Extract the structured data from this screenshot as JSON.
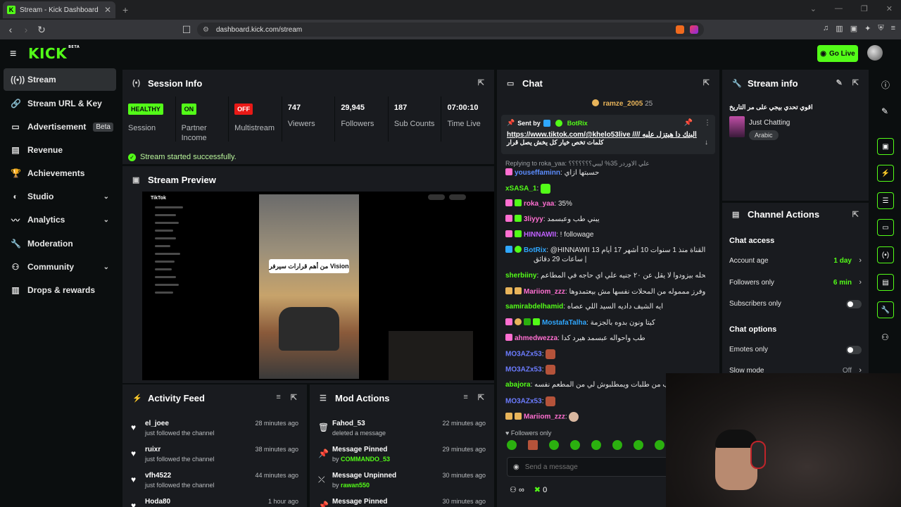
{
  "browser": {
    "tab_title": "Stream - Kick Dashboard",
    "url": "dashboard.kick.com/stream"
  },
  "header": {
    "logo": "KICK",
    "logo_badge": "BETA",
    "go_live": "Go Live"
  },
  "sidebar": {
    "items": [
      {
        "label": "Stream",
        "icon": "broadcast-icon"
      },
      {
        "label": "Stream URL & Key",
        "icon": "link-icon"
      },
      {
        "label": "Advertisement",
        "icon": "ad-icon",
        "badge": "Beta"
      },
      {
        "label": "Revenue",
        "icon": "chart-icon"
      },
      {
        "label": "Achievements",
        "icon": "trophy-icon"
      },
      {
        "label": "Studio",
        "icon": "palette-icon"
      },
      {
        "label": "Analytics",
        "icon": "analytics-icon"
      },
      {
        "label": "Moderation",
        "icon": "wrench-icon"
      },
      {
        "label": "Community",
        "icon": "community-icon"
      },
      {
        "label": "Drops & rewards",
        "icon": "gift-icon"
      }
    ]
  },
  "session": {
    "title": "Session Info",
    "stats": [
      {
        "badge": "HEALTHY",
        "label": "Session"
      },
      {
        "badge": "ON",
        "label": "Partner Income"
      },
      {
        "badge": "OFF",
        "label": "Multistream"
      },
      {
        "value": "747",
        "label": "Viewers"
      },
      {
        "value": "29,945",
        "label": "Followers"
      },
      {
        "value": "187",
        "label": "Sub Counts"
      },
      {
        "value": "07:00:10",
        "label": "Time Live"
      }
    ],
    "success": "Stream started successfully."
  },
  "preview": {
    "title": "Stream Preview",
    "tiktok_logo": "TikTok",
    "caption": "من أهم قرارات سيرفر Vision"
  },
  "activity": {
    "title": "Activity Feed",
    "items": [
      {
        "name": "el_joee",
        "text": "just followed the channel",
        "time": "28 minutes ago"
      },
      {
        "name": "ruixr",
        "text": "just followed the channel",
        "time": "38 minutes ago"
      },
      {
        "name": "vfh4522",
        "text": "just followed the channel",
        "time": "44 minutes ago"
      },
      {
        "name": "Hoda80",
        "text": "",
        "time": "1 hour ago"
      }
    ]
  },
  "mod": {
    "title": "Mod Actions",
    "items": [
      {
        "name": "Fahod_53",
        "text": "deleted a message",
        "by": "",
        "time": "22 minutes ago"
      },
      {
        "name": "Message Pinned",
        "text": "by ",
        "by": "COMMANDO_53",
        "time": "29 minutes ago"
      },
      {
        "name": "Message Unpinned",
        "text": "by ",
        "by": "rawan550",
        "time": "30 minutes ago"
      },
      {
        "name": "Message Pinned",
        "text": "",
        "by": "",
        "time": "30 minutes ago"
      }
    ]
  },
  "chat": {
    "title": "Chat",
    "gift_user": "ramze_2005",
    "gift_count": "25",
    "pinned": {
      "sent_by": "Sent by",
      "sender": "BotRix",
      "link": "https://www.tiktok.com/@khelo53live",
      "text1": "//// البنك دا هيتزل عليه",
      "text2": "كلمات تخص خيار كل يخش يصل قرار"
    },
    "replying": "Replying to roka_yaa: علي الاوردر 35% ليبي؟؟؟؟؟؟؟",
    "messages": [
      {
        "user": "youseffaminn",
        "color": "#5b8cff",
        "text": "حسبتها ازاي"
      },
      {
        "user": "xSASA_1",
        "color": "#53fc18",
        "text": ""
      },
      {
        "user": "roka_yaa",
        "color": "#ff6fd1",
        "text": "35%"
      },
      {
        "user": "3liyyy",
        "color": "#ff6fd1",
        "text": "يبني طب وعبسمد"
      },
      {
        "user": "HINNAWII",
        "color": "#c061ff",
        "text": "! followage"
      },
      {
        "user": "BotRix",
        "color": "#2fa7ff",
        "text": "@HINNAWII 13 يتابع القناة منذ 1 سنوات 10 أشهر 17 أيام"
      },
      {
        "user": "",
        "color": "#ffffff",
        "text": "ساعات 29 دقائق |"
      },
      {
        "user": "sherbiiny",
        "color": "#53fc18",
        "text": "عندي في المحله بيزودوا لا يقل عن ٢٠ جنيه علي اي حاجه في المطاعم"
      },
      {
        "user": "Mariiom_zzz",
        "color": "#ff6fd1",
        "text": "واي اوفرز ممموله من المحلات نفسها مش بيعتمدوها"
      },
      {
        "user": "samirabdelhamid",
        "color": "#53fc18",
        "text": "ايه الشيف داديه السيد اللي عصاه"
      },
      {
        "user": "MostafaTalha",
        "color": "#2fa7ff",
        "text": "كيتا ونون بدوه بالجزمة"
      },
      {
        "user": "ahmedwezza",
        "color": "#ff6fd1",
        "text": "طب واحواله عبسمد هيرد كدا"
      },
      {
        "user": "MO3AZx53",
        "color": "#6c7cff",
        "text": ""
      },
      {
        "user": "MO3AZx53",
        "color": "#6c7cff",
        "text": ""
      },
      {
        "user": "abajora",
        "color": "#53fc18",
        "text": "في الناس بتطلب من طلبات ويمطلبوش لي من المطعم نفسه"
      },
      {
        "user": "MO3AZx53",
        "color": "#6c7cff",
        "text": ""
      },
      {
        "user": "Mariiom_zzz",
        "color": "#ff6fd1",
        "text": ""
      }
    ],
    "followers_only": "Followers only",
    "input_placeholder": "Send a message",
    "infinity": "∞",
    "count": "0"
  },
  "stream_info": {
    "title": "Stream info",
    "stream_title": "اقوي تحدي بيجي على مر التاريخ",
    "category": "Just Chatting",
    "tag": "Arabic"
  },
  "channel_actions": {
    "title": "Channel Actions",
    "chat_access": "Chat access",
    "account_age": {
      "label": "Account age",
      "value": "1 day"
    },
    "followers_only": {
      "label": "Followers only",
      "value": "6 min"
    },
    "subscribers_only": {
      "label": "Subscribers only"
    },
    "chat_options": "Chat options",
    "emotes_only": {
      "label": "Emotes only"
    },
    "slow_mode": {
      "label": "Slow mode",
      "value": "Off"
    }
  },
  "colors": {
    "accent": "#53fc18",
    "panel": "#191b1f",
    "bg": "#0b0e0f",
    "danger": "#e91916"
  }
}
